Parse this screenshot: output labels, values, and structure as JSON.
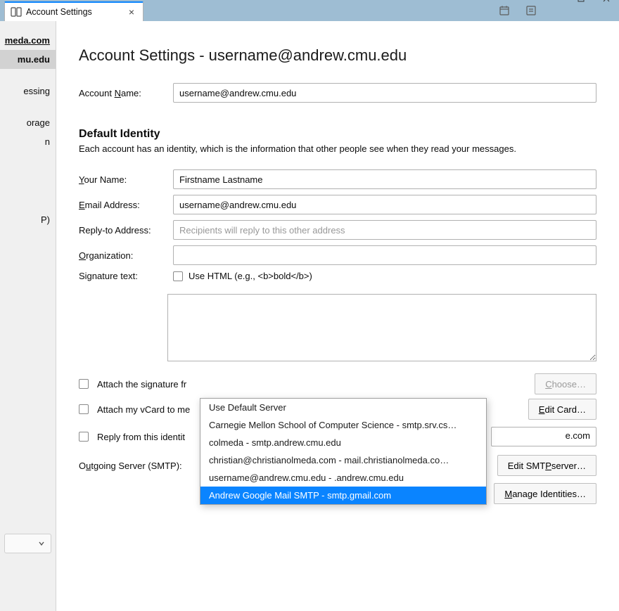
{
  "tab": {
    "title": "Account Settings"
  },
  "sidebar": {
    "items": [
      {
        "label": "meda.com",
        "bold": true
      },
      {
        "label": "mu.edu",
        "selected": true
      },
      {
        "label": "essing"
      },
      {
        "label": "orage"
      },
      {
        "label": "n"
      },
      {
        "label": ""
      },
      {
        "label": ""
      },
      {
        "label": "P)"
      }
    ]
  },
  "page": {
    "title": "Account Settings - username@andrew.cmu.edu",
    "account_name_label": "Account Name:",
    "account_name_u": "N",
    "account_name_post": "ame:",
    "account_name_pre": "Account ",
    "account_name_value": "username@andrew.cmu.edu"
  },
  "identity": {
    "section_title": "Default Identity",
    "section_desc": "Each account has an identity, which is the information that other people see when they read your messages.",
    "your_name_pre": "",
    "your_name_u": "Y",
    "your_name_post": "our Name:",
    "your_name_value": "Firstname Lastname",
    "email_pre": "",
    "email_u": "E",
    "email_post": "mail Address:",
    "email_value": "username@andrew.cmu.edu",
    "reply_label": "Reply-to Address:",
    "reply_placeholder": "Recipients will reply to this other address",
    "org_pre": "",
    "org_u": "O",
    "org_post": "rganization:",
    "sig_text_label": "Signature text:",
    "use_html_pre": "Use HTM",
    "use_html_u": "L",
    "use_html_post": " (e.g., <b>bold</b>)",
    "attach_sig_label": "Attach the signature fr",
    "attach_vcard_pre": "Attach my ",
    "attach_vcard_u": "v",
    "attach_vcard_post": "Card to me",
    "reply_from_label": "Reply from this identit",
    "reply_from_visible_tail": "e.com",
    "outgoing_pre": "O",
    "outgoing_u": "u",
    "outgoing_post": "tgoing Server (SMTP):",
    "selected_smtp": "Andrew Google Mail SMTP - smtp.gmail.com",
    "choose_pre": "",
    "choose_u": "C",
    "choose_post": "hoose…",
    "edit_card_pre": "",
    "edit_card_u": "E",
    "edit_card_post": "dit Card…",
    "edit_smtp_pre": "Edit SMT",
    "edit_smtp_u": "P",
    "edit_smtp_post": " server…",
    "manage_pre": "",
    "manage_u": "M",
    "manage_post": "anage Identities…"
  },
  "dropdown": {
    "items": [
      "Use Default Server",
      "Carnegie Mellon School of Computer Science - smtp.srv.cs…",
      "colmeda - smtp.andrew.cmu.edu",
      "christian@christianolmeda.com - mail.christianolmeda.co…",
      "username@andrew.cmu.edu - .andrew.cmu.edu",
      "Andrew Google Mail SMTP - smtp.gmail.com"
    ],
    "highlight_index": 5
  }
}
